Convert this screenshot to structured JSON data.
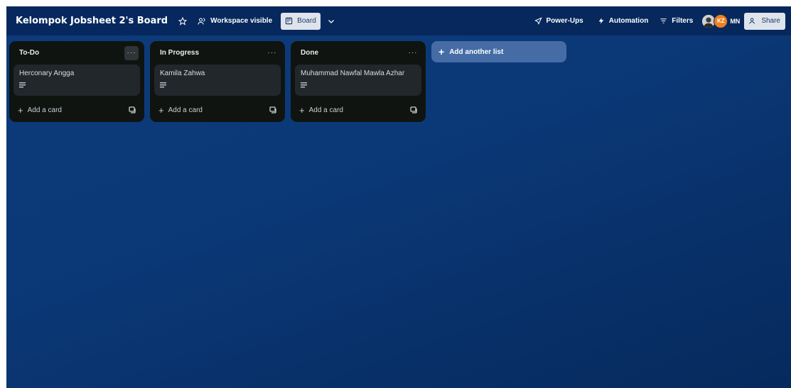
{
  "header": {
    "title": "Kelompok Jobsheet 2's Board",
    "visibility_label": "Workspace visible",
    "view_label": "Board",
    "power_ups_label": "Power-Ups",
    "automation_label": "Automation",
    "filters_label": "Filters",
    "members": [
      {
        "type": "photo"
      },
      {
        "initials": "KZ",
        "color": "#f0801e"
      },
      {
        "initials": "MN"
      }
    ],
    "share_label": "Share"
  },
  "lists": [
    {
      "title": "To-Do",
      "cards": [
        {
          "title": "Herconary Angga",
          "has_description": true
        }
      ],
      "add_card_label": "Add a card"
    },
    {
      "title": "In Progress",
      "cards": [
        {
          "title": "Kamila Zahwa",
          "has_description": true
        }
      ],
      "add_card_label": "Add a card"
    },
    {
      "title": "Done",
      "cards": [
        {
          "title": "Muhammad Nawfal Mawla Azhar",
          "has_description": true
        }
      ],
      "add_card_label": "Add a card"
    }
  ],
  "add_list_label": "Add another list",
  "colors": {
    "board_background": "#0b3978",
    "list_background": "#0f1410",
    "card_background": "#22272b",
    "accent_avatar": "#f0801e"
  }
}
